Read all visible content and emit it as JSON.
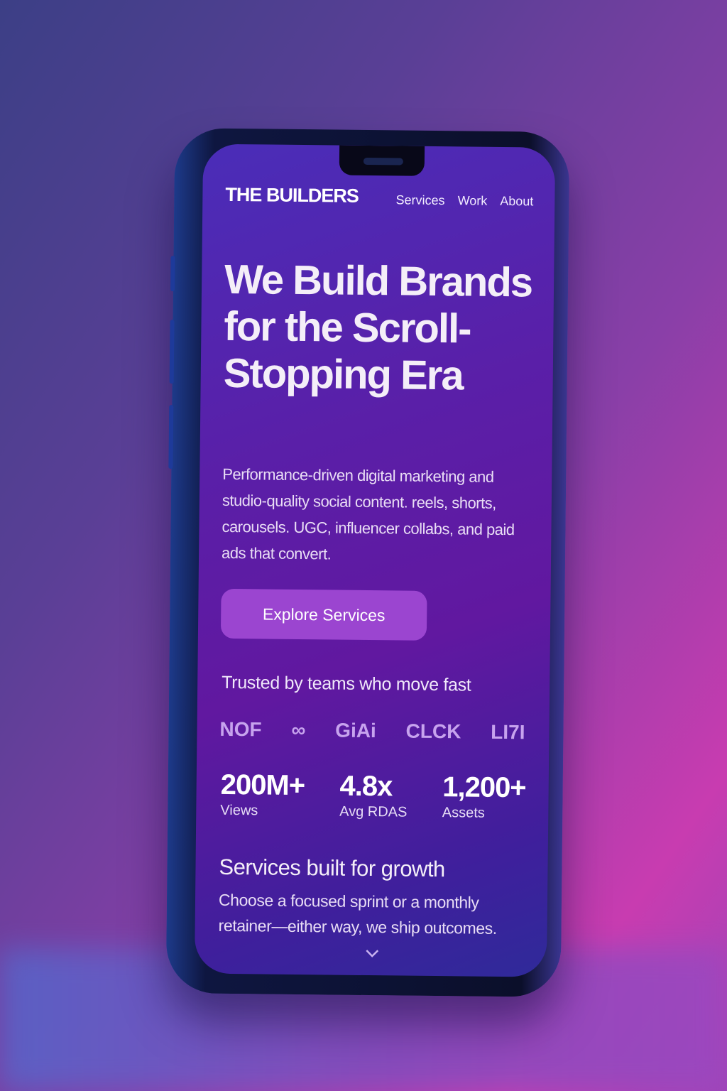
{
  "nav": {
    "brand": "THE BUILDERS",
    "links": [
      "Services",
      "Work",
      "About"
    ]
  },
  "hero": {
    "title": "We Build Brands for the Scroll-Stopping Era",
    "lede": "Performance-driven digital marketing and studio-quality social content. reels, shorts, carousels. UGC, influencer collabs, and paid ads that convert.",
    "cta_label": "Explore Services"
  },
  "trust": {
    "heading": "Trusted by teams who move fast",
    "logos": [
      "NOF",
      "∞",
      "GiAi",
      "CLCK",
      "LI7I"
    ]
  },
  "stats": [
    {
      "value": "200M+",
      "label": "Views"
    },
    {
      "value": "4.8x",
      "label": "Avg RDAS"
    },
    {
      "value": "1,200+",
      "label": "Assets"
    }
  ],
  "services": {
    "heading": "Services built for growth",
    "subtitle": "Choose a focused sprint or a monthly retainer—either way, we ship outcomes."
  },
  "scroll_icon": "chevron-down-icon",
  "colors": {
    "accent": "#9b45d0",
    "screen": "#5a1fa8",
    "background_pink": "#c83cb0"
  }
}
